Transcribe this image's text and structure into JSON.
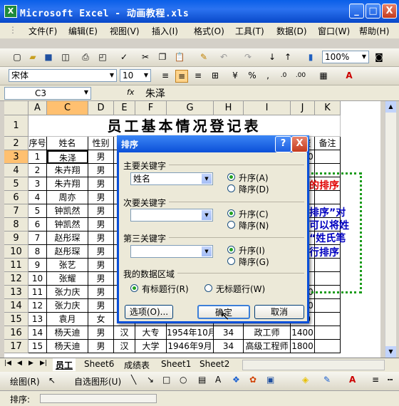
{
  "window": {
    "title": "Microsoft Excel - 动画教程.xls",
    "min": "_",
    "max": "□",
    "close": "X"
  },
  "menu": [
    "文件(F)",
    "编辑(E)",
    "视图(V)",
    "插入(I)",
    "格式(O)",
    "工具(T)",
    "数据(D)",
    "窗口(W)",
    "帮助(H)"
  ],
  "toolbar": {
    "zoom": "100%",
    "font_name": "宋体",
    "font_size": "10"
  },
  "formula": {
    "name_box": "C3",
    "fx": "fx",
    "content": "朱泽"
  },
  "columns": [
    "A",
    "C",
    "D",
    "E",
    "F",
    "G",
    "H",
    "I",
    "J",
    "K"
  ],
  "rows": [
    "1",
    "2",
    "3",
    "4",
    "5",
    "6",
    "7",
    "8",
    "9",
    "10",
    "11",
    "12",
    "13",
    "14",
    "15",
    "16",
    "17"
  ],
  "sheet": {
    "title": "员工基本情况登记表",
    "headers": [
      "序号",
      "姓名",
      "性别",
      "",
      "",
      "",
      "",
      "",
      "工资",
      "备注"
    ],
    "data": [
      [
        "1",
        "朱泽",
        "男",
        "",
        "",
        "",
        "",
        "",
        "1200",
        ""
      ],
      [
        "2",
        "朱卉翔",
        "男",
        "",
        "",
        "",
        "",
        "",
        "",
        ""
      ],
      [
        "3",
        "朱卉翔",
        "男",
        "",
        "",
        "",
        "",
        "",
        "",
        ""
      ],
      [
        "4",
        "周亦",
        "男",
        "",
        "",
        "",
        "",
        "",
        "",
        ""
      ],
      [
        "5",
        "钟凯然",
        "男",
        "",
        "",
        "",
        "",
        "",
        "",
        ""
      ],
      [
        "6",
        "钟凯然",
        "男",
        "",
        "",
        "",
        "",
        "",
        "",
        ""
      ],
      [
        "7",
        "赵彤琛",
        "男",
        "",
        "",
        "",
        "",
        "",
        "",
        ""
      ],
      [
        "8",
        "赵彤琛",
        "男",
        "",
        "",
        "",
        "",
        "",
        "",
        ""
      ],
      [
        "9",
        "张艺",
        "男",
        "",
        "",
        "",
        "",
        "",
        "",
        ""
      ],
      [
        "10",
        "张耀",
        "男",
        "",
        "",
        "",
        "",
        "",
        "",
        ""
      ],
      [
        "11",
        "张力庆",
        "男",
        "",
        "",
        "",
        "",
        "",
        "1580",
        ""
      ],
      [
        "12",
        "张力庆",
        "男",
        "",
        "",
        "",
        "",
        "",
        "1580",
        ""
      ],
      [
        "13",
        "袁月",
        "女",
        "",
        "",
        "",
        "",
        "",
        "960",
        ""
      ],
      [
        "14",
        "杨天迪",
        "男",
        "汉",
        "大专",
        "1954年10月",
        "34",
        "政工师",
        "1400",
        ""
      ],
      [
        "15",
        "杨天迪",
        "男",
        "汉",
        "大学",
        "1946年9月",
        "34",
        "高级工程师",
        "1800",
        ""
      ]
    ]
  },
  "overlay": {
    "line1": "的排序",
    "line2": "排序”对",
    "line3": "可以将姓",
    "line4": "“姓氏笔",
    "line5": "行排序"
  },
  "tabs": [
    "员工",
    "Sheet6",
    "成绩表",
    "Sheet1",
    "Sheet2"
  ],
  "drawbar": {
    "draw": "绘图(R)",
    "autoshape": "自选图形(U)"
  },
  "status": {
    "text": "排序:"
  },
  "dialog": {
    "title": "排序",
    "help": "?",
    "close": "X",
    "primary_label": "主要关键字",
    "primary_value": "姓名",
    "secondary_label": "次要关键字",
    "secondary_value": "",
    "third_label": "第三关键字",
    "third_value": "",
    "asc_a": "升序(A)",
    "desc_d": "降序(D)",
    "asc_c": "升序(C)",
    "desc_n": "降序(N)",
    "asc_i": "升序(I)",
    "desc_g": "降序(G)",
    "range_label": "我的数据区域",
    "has_header": "有标题行(R)",
    "no_header": "无标题行(W)",
    "options_btn": "选项(O)...",
    "ok_btn": "确定",
    "cancel_btn": "取消"
  }
}
